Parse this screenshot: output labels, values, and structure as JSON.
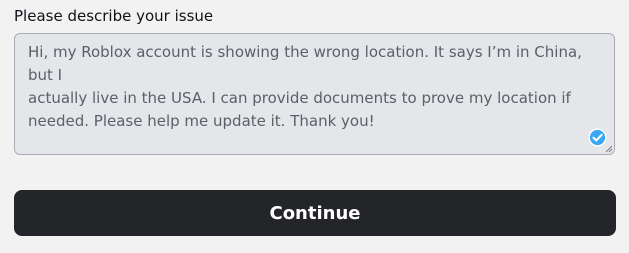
{
  "form": {
    "label": "Please describe your issue",
    "issue_value": "Hi, my Roblox account is showing the wrong location. It says I’m in China, but I\nactually live in the USA. I can provide documents to prove my location if\nneeded. Please help me update it. Thank you!",
    "continue_label": "Continue"
  },
  "colors": {
    "background": "#f2f2f3",
    "textarea_bg": "#e4e6ea",
    "button_bg": "#232529",
    "verified_blue": "#3ba7f2"
  },
  "icons": {
    "verified": "check-circle-icon",
    "resize": "resize-grip-icon"
  }
}
